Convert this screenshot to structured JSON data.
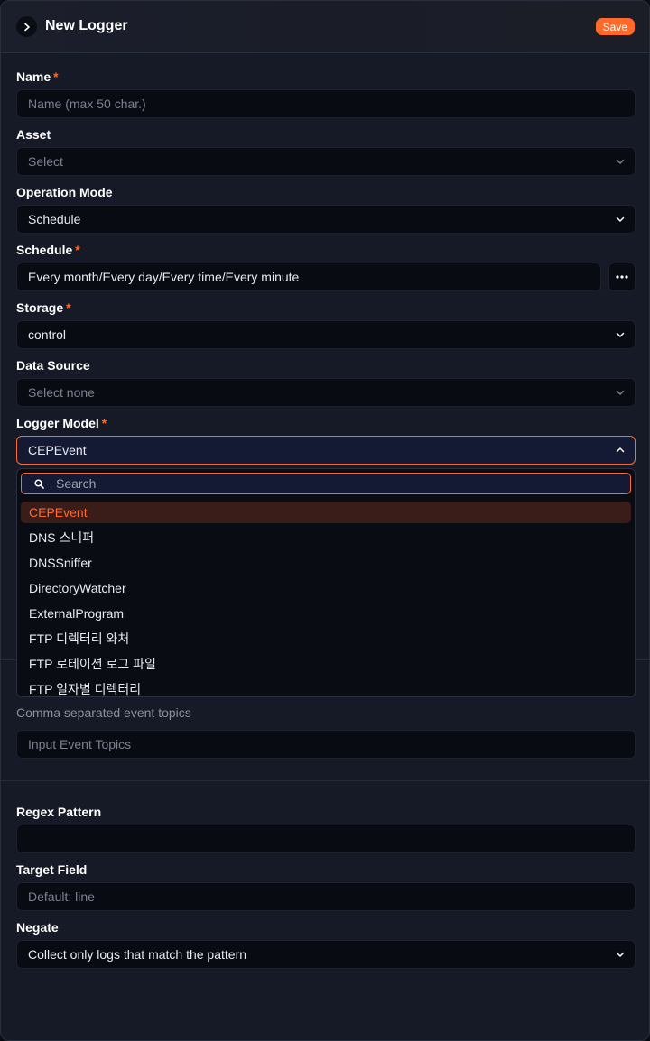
{
  "header": {
    "title": "New Logger",
    "save_label": "Save"
  },
  "form": {
    "name": {
      "label": "Name",
      "required_mark": "*",
      "placeholder": "Name (max 50 char.)"
    },
    "asset": {
      "label": "Asset",
      "placeholder": "Select"
    },
    "operation_mode": {
      "label": "Operation Mode",
      "value": "Schedule"
    },
    "schedule": {
      "label": "Schedule",
      "required_mark": "*",
      "value": "Every month/Every day/Every time/Every minute"
    },
    "storage": {
      "label": "Storage",
      "required_mark": "*",
      "value": "control"
    },
    "data_source": {
      "label": "Data Source",
      "placeholder": "Select none"
    },
    "logger_model": {
      "label": "Logger Model",
      "required_mark": "*",
      "value": "CEPEvent"
    },
    "event_topics": {
      "hint": "Comma separated event topics",
      "placeholder": "Input Event Topics"
    },
    "regex_pattern": {
      "label": "Regex Pattern",
      "value": ""
    },
    "target_field": {
      "label": "Target Field",
      "placeholder": "Default: line"
    },
    "negate": {
      "label": "Negate",
      "value": "Collect only logs that match the pattern"
    }
  },
  "dropdown": {
    "search_placeholder": "Search",
    "items": [
      "CEPEvent",
      "DNS 스니퍼",
      "DNSSniffer",
      "DirectoryWatcher",
      "ExternalProgram",
      "FTP 디렉터리 와처",
      "FTP 로테이션 로그 파일",
      "FTP 일자별 디렉터리"
    ],
    "selected_index": 0
  },
  "colors": {
    "accent": "#ff6a2b",
    "panel": "#161a26",
    "field": "#090b12"
  }
}
